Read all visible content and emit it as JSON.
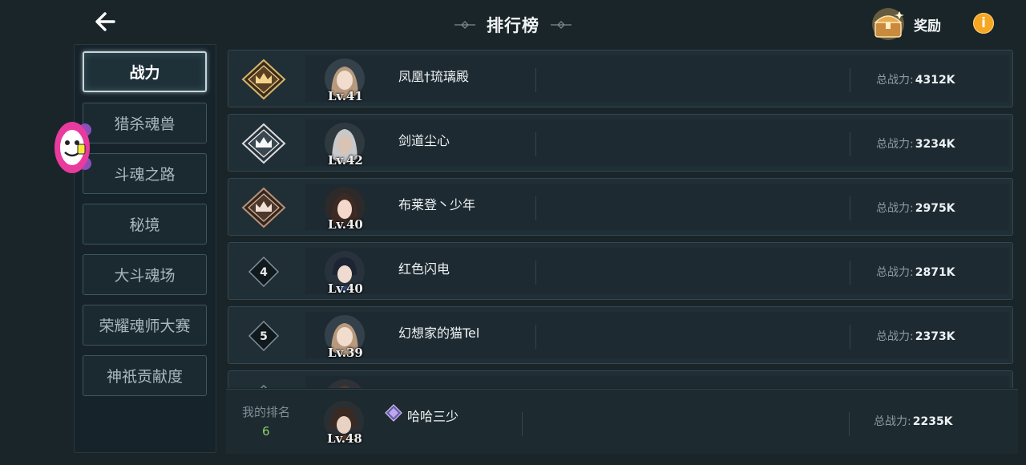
{
  "header": {
    "title": "排行榜",
    "reward_label": "奖励",
    "info_label": "i",
    "back_icon": "back-arrow-icon"
  },
  "sidebar": {
    "tabs": [
      {
        "label": "战力",
        "active": true
      },
      {
        "label": "猎杀魂兽",
        "active": false
      },
      {
        "label": "斗魂之路",
        "active": false
      },
      {
        "label": "秘境",
        "active": false
      },
      {
        "label": "大斗魂场",
        "active": false
      },
      {
        "label": "荣耀魂师大赛",
        "active": false
      },
      {
        "label": "神祇贡献度",
        "active": false
      }
    ]
  },
  "ranking": {
    "power_label": "总战力:",
    "rows": [
      {
        "rank": "1",
        "medal": "gold",
        "level": "Lv.41",
        "name": "凤凰†琉璃殿",
        "power": "4312K"
      },
      {
        "rank": "2",
        "medal": "silver",
        "level": "Lv.42",
        "name": "剑道尘心",
        "power": "3234K"
      },
      {
        "rank": "3",
        "medal": "bronze",
        "level": "Lv.40",
        "name": "布莱登丶少年",
        "power": "2975K"
      },
      {
        "rank": "4",
        "medal": "none",
        "level": "Lv.40",
        "name": "红色闪电",
        "power": "2871K"
      },
      {
        "rank": "5",
        "medal": "none",
        "level": "Lv.39",
        "name": "幻想家的猫Tel",
        "power": "2373K"
      },
      {
        "rank": "6",
        "medal": "none",
        "level": "",
        "name": "",
        "power": ""
      }
    ]
  },
  "my_rank": {
    "label": "我的排名",
    "rank": "6",
    "level": "Lv.48",
    "name": "哈哈三少",
    "power_label": "总战力:",
    "power": "2235K"
  },
  "colors": {
    "background": "#1a2529",
    "gold": "#d8b56a",
    "silver": "#d6dde2",
    "bronze": "#b89176",
    "accent_green": "#8fd06a",
    "info_orange": "#f5a623"
  }
}
